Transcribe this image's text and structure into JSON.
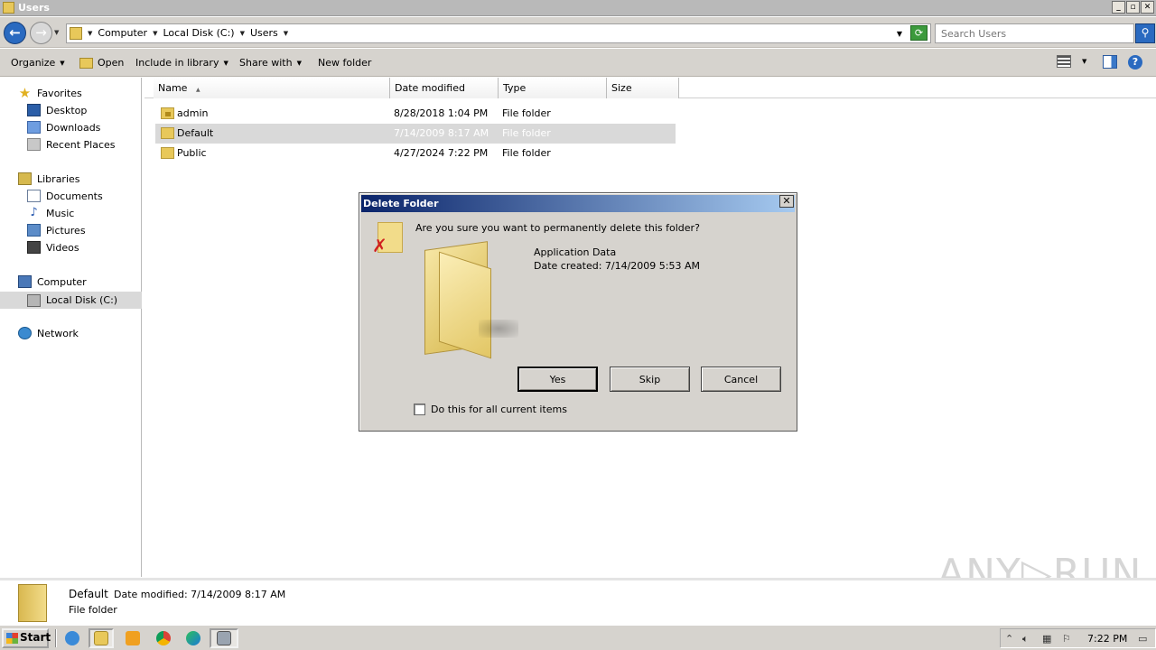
{
  "window": {
    "title": "Users",
    "min_label": "_",
    "max_label": "▫",
    "close_label": "✕"
  },
  "address": {
    "crumbs": [
      "Computer",
      "Local Disk (C:)",
      "Users"
    ],
    "search_placeholder": "Search Users"
  },
  "toolbar": {
    "organize": "Organize",
    "open": "Open",
    "include_in_library": "Include in library",
    "share_with": "Share with",
    "new_folder": "New folder",
    "help": "?"
  },
  "nav": {
    "favorites": "Favorites",
    "desktop": "Desktop",
    "downloads": "Downloads",
    "recent_places": "Recent Places",
    "libraries": "Libraries",
    "documents": "Documents",
    "music": "Music",
    "pictures": "Pictures",
    "videos": "Videos",
    "computer": "Computer",
    "local_disk": "Local Disk (C:)",
    "network": "Network"
  },
  "columns": {
    "name": "Name",
    "date_modified": "Date modified",
    "type": "Type",
    "size": "Size"
  },
  "files": [
    {
      "name": "admin",
      "date": "8/28/2018 1:04 PM",
      "type": "File folder",
      "icon": "locked-folder-icon"
    },
    {
      "name": "Default",
      "date": "7/14/2009 8:17 AM",
      "type": "File folder",
      "icon": "folder-icon",
      "selected": true
    },
    {
      "name": "Public",
      "date": "4/27/2024 7:22 PM",
      "type": "File folder",
      "icon": "folder-icon"
    }
  ],
  "details": {
    "name": "Default",
    "date_modified": "Date modified: 7/14/2009 8:17 AM",
    "type": "File folder"
  },
  "dialog": {
    "title": "Delete Folder",
    "close": "✕",
    "question": "Are you sure you want to permanently delete this folder?",
    "item_name": "Application Data",
    "item_date": "Date created: 7/14/2009 5:53 AM",
    "yes": "Yes",
    "skip": "Skip",
    "cancel": "Cancel",
    "checkbox_label": "Do this for all current items"
  },
  "taskbar": {
    "start": "Start",
    "clock": "7:22 PM"
  },
  "watermark": "ANY▷RUN"
}
